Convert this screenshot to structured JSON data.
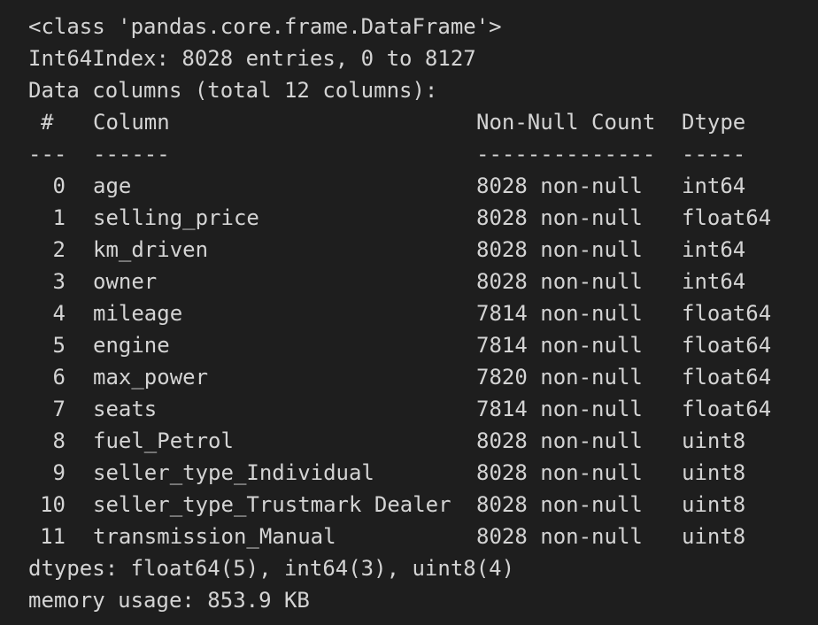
{
  "header": {
    "class_line": "<class 'pandas.core.frame.DataFrame'>",
    "index_line": "Int64Index: 8028 entries, 0 to 8127",
    "columns_line": "Data columns (total 12 columns):"
  },
  "table": {
    "headers": {
      "idx": "#",
      "column": "Column",
      "count": "Non-Null Count",
      "dtype": "Dtype"
    },
    "separators": {
      "idx": "---",
      "column": "------",
      "count": "--------------",
      "dtype": "-----"
    },
    "rows": [
      {
        "idx": "0",
        "column": "age",
        "count": "8028 non-null",
        "dtype": "int64"
      },
      {
        "idx": "1",
        "column": "selling_price",
        "count": "8028 non-null",
        "dtype": "float64"
      },
      {
        "idx": "2",
        "column": "km_driven",
        "count": "8028 non-null",
        "dtype": "int64"
      },
      {
        "idx": "3",
        "column": "owner",
        "count": "8028 non-null",
        "dtype": "int64"
      },
      {
        "idx": "4",
        "column": "mileage",
        "count": "7814 non-null",
        "dtype": "float64"
      },
      {
        "idx": "5",
        "column": "engine",
        "count": "7814 non-null",
        "dtype": "float64"
      },
      {
        "idx": "6",
        "column": "max_power",
        "count": "7820 non-null",
        "dtype": "float64"
      },
      {
        "idx": "7",
        "column": "seats",
        "count": "7814 non-null",
        "dtype": "float64"
      },
      {
        "idx": "8",
        "column": "fuel_Petrol",
        "count": "8028 non-null",
        "dtype": "uint8"
      },
      {
        "idx": "9",
        "column": "seller_type_Individual",
        "count": "8028 non-null",
        "dtype": "uint8"
      },
      {
        "idx": "10",
        "column": "seller_type_Trustmark Dealer",
        "count": "8028 non-null",
        "dtype": "uint8"
      },
      {
        "idx": "11",
        "column": "transmission_Manual",
        "count": "8028 non-null",
        "dtype": "uint8"
      }
    ]
  },
  "footer": {
    "dtypes_line": "dtypes: float64(5), int64(3), uint8(4)",
    "memory_line": "memory usage: 853.9 KB"
  }
}
